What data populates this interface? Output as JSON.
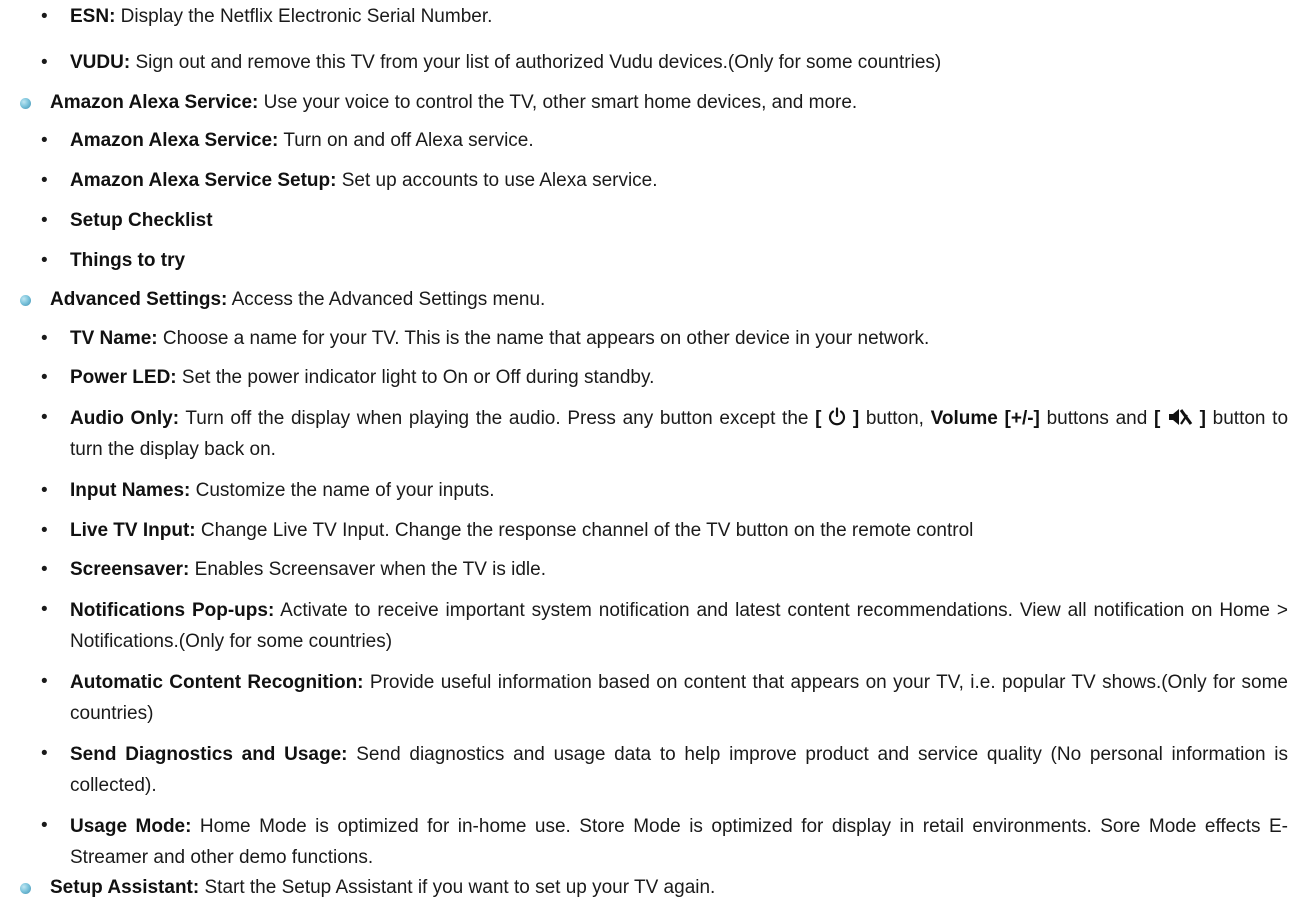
{
  "items": [
    {
      "level": "sub",
      "term": "ESN:",
      "desc": " Display the Netflix Electronic Serial Number."
    },
    {
      "level": "sub",
      "term": "VUDU:",
      "desc": " Sign out and remove this TV from your list of authorized Vudu devices.(Only for some countries)"
    },
    {
      "level": "top",
      "term": "Amazon Alexa Service:",
      "desc": " Use your voice to control the TV, other smart home devices, and more."
    },
    {
      "level": "sub",
      "term": "Amazon Alexa Service:",
      "desc": " Turn on and off Alexa service."
    },
    {
      "level": "sub",
      "term": "Amazon Alexa Service Setup:",
      "desc": " Set up accounts to use Alexa service."
    },
    {
      "level": "sub",
      "term": "Setup Checklist",
      "desc": ""
    },
    {
      "level": "sub",
      "term": "Things to try",
      "desc": ""
    },
    {
      "level": "top",
      "term": "Advanced Settings:",
      "desc": " Access the Advanced Settings menu."
    },
    {
      "level": "sub",
      "term": "TV Name:",
      "desc": " Choose a name for your TV. This is the name that appears on other device in your network."
    },
    {
      "level": "sub",
      "term": "Power LED:",
      "desc": " Set the power indicator light to On or Off during standby."
    },
    {
      "level": "sub",
      "term": "Audio Only:",
      "desc_a": " Turn off the display when playing the audio. Press any button except the ",
      "btn_open": "[",
      "btn_close": "]",
      "desc_b": " button, ",
      "volume": "Volume [+/-]",
      "desc_c": " buttons and ",
      "desc_d": " button to turn the display back on.",
      "power_icon": "power-icon",
      "mute_icon": "mute-icon"
    },
    {
      "level": "sub",
      "term": "Input Names:",
      "desc": " Customize the name of your inputs."
    },
    {
      "level": "sub",
      "term": "Live TV Input:",
      "desc": " Change Live TV Input. Change the response channel of the TV button on the remote control"
    },
    {
      "level": "sub",
      "term": "Screensaver:",
      "desc": " Enables Screensaver when the TV is idle."
    },
    {
      "level": "sub",
      "term": "Notifications Pop-ups:",
      "desc": " Activate to receive important system notification and latest content recommendations. View all notification on Home > Notifications.(Only for some countries)"
    },
    {
      "level": "sub",
      "term": "Automatic Content Recognition:",
      "desc": " Provide useful information based on content that appears on your TV, i.e. popular TV shows.(Only for some countries)"
    },
    {
      "level": "sub",
      "term": "Send Diagnostics and Usage:",
      "desc": " Send diagnostics and usage data to help improve product and service quality (No personal information is collected)."
    },
    {
      "level": "sub",
      "term": "Usage Mode:",
      "desc": " Home Mode is optimized for in-home use. Store Mode is optimized for display in retail environments. Sore Mode effects E-Streamer and other demo functions."
    },
    {
      "level": "top",
      "term": "Setup Assistant:",
      "desc": " Start the Setup Assistant if you want to set up your TV again."
    }
  ],
  "bullet_char": "•",
  "colors": {
    "dot": "#5aaecb",
    "text": "#1a1a1a"
  }
}
